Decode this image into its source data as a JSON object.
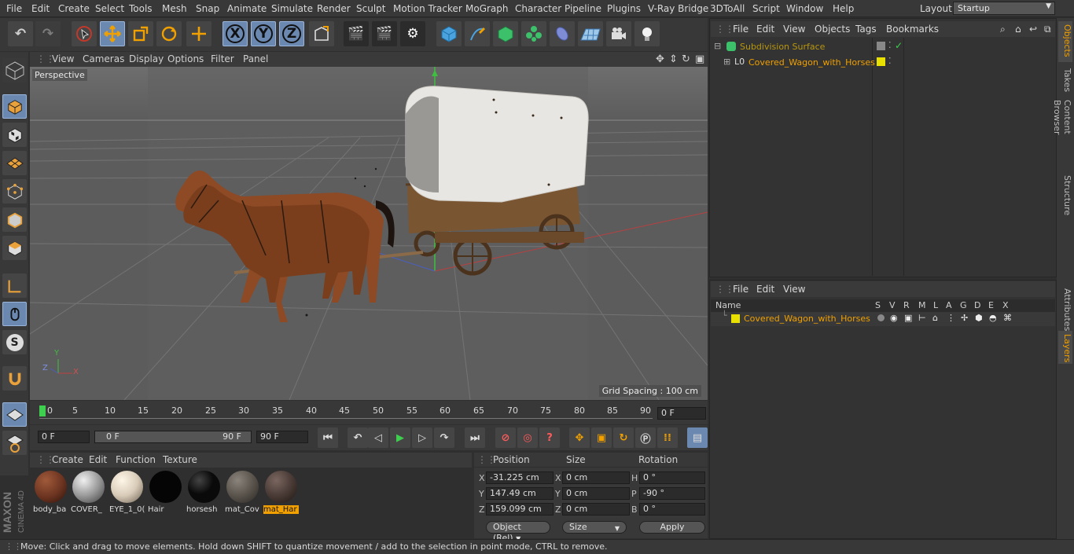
{
  "menubar": {
    "items": [
      "File",
      "Edit",
      "Create",
      "Select",
      "Tools",
      "Mesh",
      "Snap",
      "Animate",
      "Simulate",
      "Render",
      "Sculpt",
      "Motion Tracker",
      "MoGraph",
      "Character",
      "Pipeline",
      "Plugins",
      "V-Ray Bridge",
      "3DToAll",
      "Script",
      "Window",
      "Help"
    ],
    "layout_label": "Layout:",
    "layout_value": "Startup"
  },
  "toolbar": {
    "x": "X",
    "y": "Y",
    "z": "Z"
  },
  "viewport": {
    "menu": [
      "View",
      "Cameras",
      "Display",
      "Options",
      "Filter",
      "Panel"
    ],
    "label": "Perspective",
    "grid_spacing": "Grid Spacing : 100 cm",
    "axis_x": "X",
    "axis_y": "Y",
    "axis_z": "Z"
  },
  "timeline": {
    "ticks": [
      "0",
      "5",
      "10",
      "15",
      "20",
      "25",
      "30",
      "35",
      "40",
      "45",
      "50",
      "55",
      "60",
      "65",
      "70",
      "75",
      "80",
      "85",
      "90"
    ],
    "current_frame": "0 F",
    "start": "0 F",
    "range_start": "0 F",
    "range_end": "90 F",
    "end": "90 F"
  },
  "materials": {
    "menu": [
      "Create",
      "Edit",
      "Function",
      "Texture"
    ],
    "items": [
      {
        "name": "body_ba",
        "color": "#6b3320"
      },
      {
        "name": "COVER_",
        "color": "#9a9a9a"
      },
      {
        "name": "EYE_1_0(",
        "color": "#d8cbb8"
      },
      {
        "name": "Hair",
        "color": "#050505"
      },
      {
        "name": "horsesh",
        "color": "#0a0a0a"
      },
      {
        "name": "mat_Cov",
        "color": "#5a544d"
      },
      {
        "name": "mat_Har",
        "color": "#4a3b36"
      }
    ]
  },
  "coords": {
    "head_position": "Position",
    "head_size": "Size",
    "head_rotation": "Rotation",
    "pos_x": "-31.225 cm",
    "pos_y": "147.49 cm",
    "pos_z": "159.099 cm",
    "size_x": "0 cm",
    "size_y": "0 cm",
    "size_z": "0 cm",
    "rot_h": "0 °",
    "rot_p": "-90 °",
    "rot_b": "0 °",
    "lbl_x": "X",
    "lbl_y": "Y",
    "lbl_z": "Z",
    "lbl_h": "H",
    "lbl_p": "P",
    "lbl_b": "B",
    "mode": "Object (Rel)",
    "size_mode": "Size",
    "apply": "Apply"
  },
  "objects": {
    "menu": [
      "File",
      "Edit",
      "View",
      "Objects",
      "Tags",
      "Bookmarks"
    ],
    "rows": [
      "Subdivision Surface",
      "Covered_Wagon_with_Horses"
    ]
  },
  "layers": {
    "menu": [
      "File",
      "Edit",
      "View"
    ],
    "headers": [
      "Name",
      "S",
      "V",
      "R",
      "M",
      "L",
      "A",
      "G",
      "D",
      "E",
      "X"
    ],
    "rows": [
      "Covered_Wagon_with_Horses"
    ]
  },
  "right_tabs": [
    "Objects",
    "Takes",
    "Content Browser",
    "Structure",
    "Attributes",
    "Layers"
  ],
  "status": "Move: Click and drag to move elements. Hold down SHIFT to quantize movement / add to the selection in point mode, CTRL to remove.",
  "colors": {
    "accent": "#f0a000",
    "selected_tool": "#6b88b0",
    "layer_color": "#e8e000"
  },
  "logo": {
    "brand": "MAXON",
    "product": "CINEMA 4D"
  }
}
